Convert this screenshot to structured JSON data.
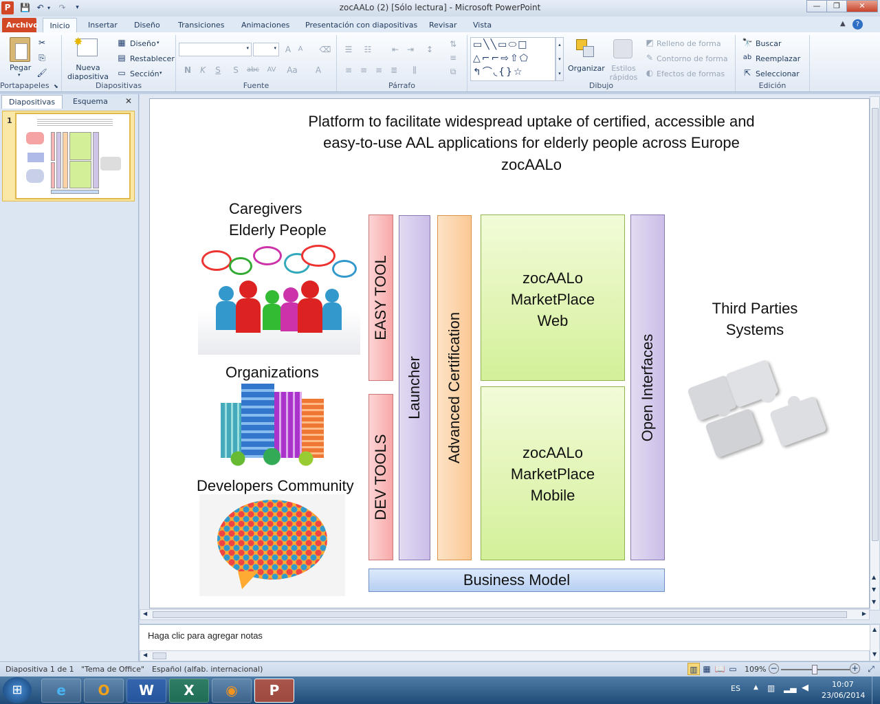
{
  "window": {
    "title": "zocAALo (2) [Sólo lectura] - Microsoft PowerPoint"
  },
  "tabs": [
    "Archivo",
    "Inicio",
    "Insertar",
    "Diseño",
    "Transiciones",
    "Animaciones",
    "Presentación con diapositivas",
    "Revisar",
    "Vista"
  ],
  "ribbon": {
    "clipboard": {
      "label": "Portapapeles",
      "paste": "Pegar"
    },
    "slides": {
      "label": "Diapositivas",
      "new_slide": "Nueva diapositiva",
      "layout": "Diseño",
      "reset": "Restablecer",
      "section": "Sección"
    },
    "font": {
      "label": "Fuente",
      "bold": "N",
      "italic": "K",
      "underline": "S",
      "shadow": "S",
      "strike": "abc",
      "spacing": "AV",
      "case": "Aa",
      "color": "A"
    },
    "paragraph": {
      "label": "Párrafo"
    },
    "drawing": {
      "label": "Dibujo",
      "arrange": "Organizar",
      "quick_styles": "Estilos rápidos",
      "shape_fill": "Relleno de forma",
      "shape_outline": "Contorno de forma",
      "shape_effects": "Efectos de formas"
    },
    "editing": {
      "label": "Edición",
      "find": "Buscar",
      "replace": "Reemplazar",
      "select": "Seleccionar"
    }
  },
  "left_pane": {
    "tab_slides": "Diapositivas",
    "tab_outline": "Esquema",
    "slide_number": "1"
  },
  "slide": {
    "title_line1": "Platform to facilitate widespread uptake of certified, accessible and",
    "title_line2": "easy-to-use AAL applications for elderly people across Europe",
    "title_line3": "zocAALo",
    "caregivers_line1": "Caregivers",
    "caregivers_line2": "Elderly People",
    "organizations": "Organizations",
    "developers": "Developers Community",
    "easy_tool": "EASY TOOL",
    "dev_tools": "DEV TOOLS",
    "launcher": "Launcher",
    "certification": "Advanced Certification",
    "market_web_1": "zocAALo",
    "market_web_2": "MarketPlace",
    "market_web_3": "Web",
    "market_mobile_1": "zocAALo",
    "market_mobile_2": "MarketPlace",
    "market_mobile_3": "Mobile",
    "open_interfaces": "Open Interfaces",
    "third_parties_1": "Third Parties",
    "third_parties_2": "Systems",
    "business_model": "Business Model"
  },
  "notes": {
    "placeholder": "Haga clic para agregar notas"
  },
  "status": {
    "slide_info": "Diapositiva 1 de 1",
    "theme": "\"Tema de Office\"",
    "language": "Español (alfab. internacional)",
    "zoom": "109%"
  },
  "taskbar": {
    "lang": "ES",
    "time": "10:07",
    "date": "23/06/2014"
  },
  "colors": {
    "file_tab": "#d24726",
    "pink": "#f8b4b4",
    "purple": "#cfc3e8",
    "orange": "#fbd2a6",
    "green": "#d3f099",
    "blue": "#c4d9f5"
  }
}
